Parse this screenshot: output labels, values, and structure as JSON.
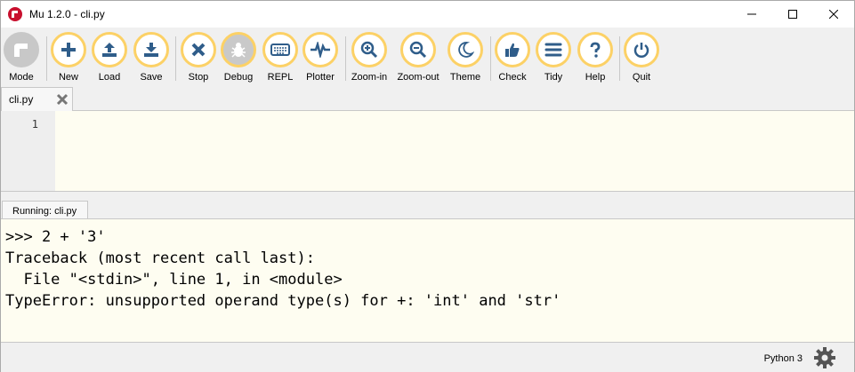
{
  "window": {
    "title": "Mu 1.2.0 - cli.py"
  },
  "toolbar": {
    "buttons": [
      {
        "label": "Mode",
        "icon": "mode-icon"
      },
      {
        "label": "New",
        "icon": "plus-icon"
      },
      {
        "label": "Load",
        "icon": "upload-icon"
      },
      {
        "label": "Save",
        "icon": "download-icon"
      },
      {
        "label": "Stop",
        "icon": "close-icon"
      },
      {
        "label": "Debug",
        "icon": "bug-icon"
      },
      {
        "label": "REPL",
        "icon": "keyboard-icon"
      },
      {
        "label": "Plotter",
        "icon": "pulse-icon"
      },
      {
        "label": "Zoom-in",
        "icon": "zoom-in-icon"
      },
      {
        "label": "Zoom-out",
        "icon": "zoom-out-icon"
      },
      {
        "label": "Theme",
        "icon": "moon-icon"
      },
      {
        "label": "Check",
        "icon": "thumbs-up-icon"
      },
      {
        "label": "Tidy",
        "icon": "lines-icon"
      },
      {
        "label": "Help",
        "icon": "question-icon"
      },
      {
        "label": "Quit",
        "icon": "power-icon"
      }
    ]
  },
  "tabs": [
    {
      "label": "cli.py"
    }
  ],
  "editor": {
    "line_numbers": [
      "1"
    ]
  },
  "runner": {
    "label": "Running: cli.py"
  },
  "repl": {
    "lines": [
      ">>> 2 + '3'",
      "Traceback (most recent call last):",
      "  File \"<stdin>\", line 1, in <module>",
      "TypeError: unsupported operand type(s) for +: 'int' and 'str'"
    ]
  },
  "status": {
    "mode": "Python 3"
  },
  "colors": {
    "accent": "#fcd166",
    "icon": "#2f5d8a",
    "editor_bg": "#fefdf1"
  }
}
